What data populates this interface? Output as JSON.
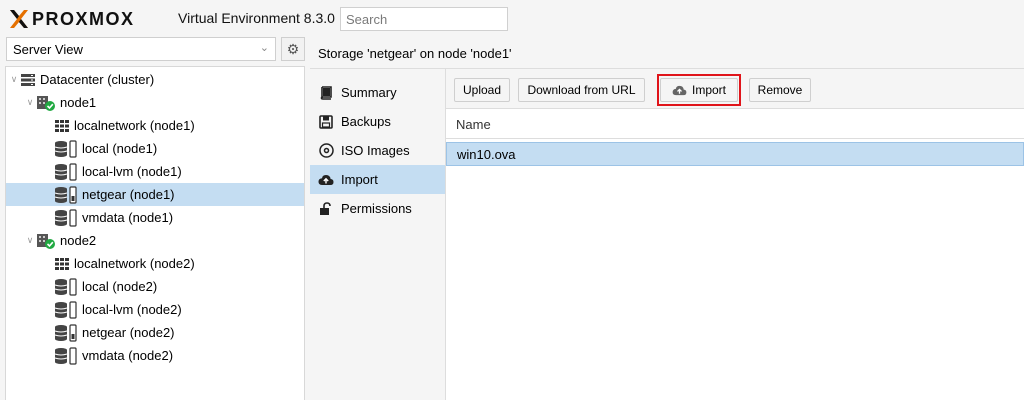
{
  "app": {
    "logo_text": "PROXMOX",
    "product": "Virtual Environment 8.3.0",
    "search_placeholder": "Search"
  },
  "sidebar": {
    "view_selected": "Server View",
    "tree": [
      {
        "label": "Datacenter (cluster)",
        "icon": "datacenter-icon"
      },
      {
        "label": "node1",
        "icon": "node-online-icon"
      },
      {
        "label": "localnetwork (node1)",
        "icon": "network-grid-icon"
      },
      {
        "label": "local (node1)",
        "icon": "storage-icon"
      },
      {
        "label": "local-lvm (node1)",
        "icon": "storage-icon"
      },
      {
        "label": "netgear (node1)",
        "icon": "storage-icon",
        "selected": true
      },
      {
        "label": "vmdata (node1)",
        "icon": "storage-icon"
      },
      {
        "label": "node2",
        "icon": "node-online-icon"
      },
      {
        "label": "localnetwork (node2)",
        "icon": "network-grid-icon"
      },
      {
        "label": "local (node2)",
        "icon": "storage-icon"
      },
      {
        "label": "local-lvm (node2)",
        "icon": "storage-icon"
      },
      {
        "label": "netgear (node2)",
        "icon": "storage-icon"
      },
      {
        "label": "vmdata (node2)",
        "icon": "storage-icon"
      }
    ]
  },
  "main": {
    "title": "Storage 'netgear' on node 'node1'",
    "nav": [
      {
        "label": "Summary",
        "icon": "book-icon"
      },
      {
        "label": "Backups",
        "icon": "floppy-icon"
      },
      {
        "label": "ISO Images",
        "icon": "disc-icon"
      },
      {
        "label": "Import",
        "icon": "cloud-upload-icon",
        "selected": true
      },
      {
        "label": "Permissions",
        "icon": "unlock-icon"
      }
    ],
    "toolbar": {
      "upload": "Upload",
      "download_url": "Download from URL",
      "import": "Import",
      "remove": "Remove"
    },
    "grid": {
      "column_name": "Name",
      "rows": [
        "win10.ova"
      ]
    }
  },
  "colors": {
    "selection": "#c4ddf2",
    "highlight_box": "#e0141a",
    "online_green": "#21a942",
    "logo_orange": "#e57000"
  }
}
